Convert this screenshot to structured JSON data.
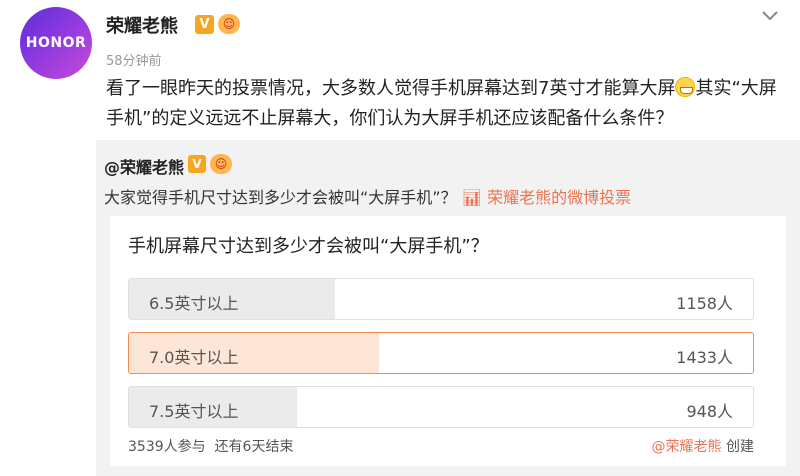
{
  "post": {
    "avatar_text": "HONOR",
    "author": "荣耀老熊",
    "verified_badge": "V",
    "timestamp": "58分钟前",
    "text_before_emoji": "看了一眼昨天的投票情况，大多数人觉得手机屏幕达到7英寸才能算大屏",
    "text_after_emoji": "其实“大屏手机”的定义远远不止屏幕大，你们认为大屏手机还应该配备什么条件？"
  },
  "repost": {
    "author": "@荣耀老熊",
    "verified_badge": "V",
    "text": "大家觉得手机尺寸达到多少才会被叫“大屏手机”？",
    "vote_link": "荣耀老熊的微博投票"
  },
  "poll": {
    "question": "手机屏幕尺寸达到多少才会被叫“大屏手机”？",
    "options": [
      {
        "label": "6.5英寸以上",
        "count": "1158人",
        "fraction": 0.33,
        "selected": false
      },
      {
        "label": "7.0英寸以上",
        "count": "1433人",
        "fraction": 0.4,
        "selected": true
      },
      {
        "label": "7.5英寸以上",
        "count": "948人",
        "fraction": 0.27,
        "selected": false
      }
    ],
    "participants": "3539人参与",
    "remaining": "还有6天结束",
    "creator": "@荣耀老熊",
    "created_label": "创建"
  },
  "colors": {
    "accent": "#eb7350",
    "selected_border": "#f28c50",
    "selected_fill": "#fde6d8",
    "option_fill": "#ebebeb"
  }
}
